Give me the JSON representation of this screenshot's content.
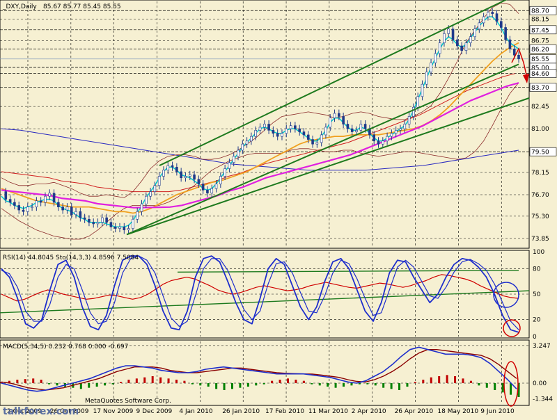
{
  "chart_data": {
    "type": "line",
    "symbol": "_DXY,Daily",
    "ohlc_readout": "85.67 85.77 85.45 85.55",
    "x_tick_labels": [
      "2 Oct 2009",
      "26 Oct 2009",
      "17 Nov 2009",
      "9 Dec 2009",
      "4 Jan 2010",
      "26 Jan 2010",
      "17 Feb 2010",
      "11 Mar 2010",
      "2 Apr 2010",
      "26 Apr 2010",
      "18 May 2010",
      "9 Jun 2010"
    ],
    "watermark": "talkforex.com",
    "copyright": "MetaQuotes Software Corp.",
    "panels": [
      {
        "name": "price",
        "ylim": [
          73.3,
          89.3
        ],
        "y_ticks": [
          88.15,
          86.75,
          85.0,
          84.6,
          82.45,
          81.0,
          78.15,
          76.7,
          75.3,
          73.85
        ],
        "boxed_labels": [
          {
            "value": 88.7,
            "text": "88.70",
            "bg": "#FFFFFF",
            "fg": "#000000"
          },
          {
            "value": 87.45,
            "text": "87.45",
            "bg": "#FFFFFF",
            "fg": "#000000"
          },
          {
            "value": 86.2,
            "text": "86.20",
            "bg": "#FFFFFF",
            "fg": "#000000"
          },
          {
            "value": 85.55,
            "text": "85.55",
            "bg": "#FFFFFF",
            "fg": "#C00000"
          },
          {
            "value": 85.0,
            "text": "85.00",
            "bg": "#FFFFFF",
            "fg": "#000000"
          },
          {
            "value": 84.6,
            "text": "84.60",
            "bg": "#FFFFFF",
            "fg": "#000000"
          },
          {
            "value": 83.7,
            "text": "83.70",
            "bg": "#FFFFFF",
            "fg": "#000000"
          },
          {
            "value": 79.5,
            "text": "79.50",
            "bg": "#FFFFFF",
            "fg": "#000000"
          }
        ],
        "horizontal_levels": [
          88.7,
          87.45,
          86.2,
          85.0,
          84.6,
          83.7,
          79.5
        ],
        "bid_line": 85.55,
        "close_series": [
          76.9,
          76.4,
          76.2,
          76.0,
          75.7,
          75.6,
          75.9,
          75.9,
          76.3,
          76.2,
          76.6,
          76.8,
          76.2,
          75.9,
          75.7,
          75.9,
          75.4,
          75.6,
          75.2,
          75.1,
          74.9,
          74.8,
          74.9,
          75.2,
          74.9,
          74.6,
          74.5,
          74.6,
          74.4,
          74.5,
          75.1,
          75.6,
          76.1,
          76.6,
          76.9,
          77.3,
          77.9,
          78.3,
          78.6,
          78.5,
          78.2,
          77.8,
          77.9,
          78.0,
          77.7,
          77.4,
          77.0,
          76.8,
          77.1,
          77.4,
          77.9,
          78.4,
          78.8,
          79.2,
          79.6,
          80.0,
          80.2,
          80.5,
          80.9,
          81.1,
          81.3,
          80.9,
          80.7,
          80.5,
          80.7,
          81.0,
          81.2,
          81.0,
          80.8,
          80.6,
          80.3,
          80.0,
          80.1,
          80.6,
          81.1,
          81.7,
          82.0,
          81.8,
          81.3,
          81.0,
          80.8,
          80.9,
          81.3,
          81.0,
          80.6,
          80.2,
          80.0,
          80.2,
          80.5,
          80.7,
          80.9,
          81.0,
          81.3,
          81.8,
          82.4,
          83.1,
          83.9,
          84.7,
          85.3,
          85.9,
          86.6,
          87.2,
          87.5,
          86.8,
          86.4,
          86.1,
          86.6,
          87.0,
          87.5,
          87.9,
          88.3,
          88.6,
          88.5,
          88.0,
          87.6,
          86.8,
          86.2,
          85.8,
          85.55
        ],
        "bb_upper": [
          77.8,
          77.5,
          77.3,
          77.3,
          77.4,
          77.4,
          77.5,
          77.3,
          77.1,
          76.8,
          76.6,
          76.6,
          76.7,
          76.6,
          76.5,
          76.9,
          77.6,
          78.4,
          78.9,
          79.2,
          79.3,
          79.3,
          79.2,
          79.0,
          79.0,
          79.1,
          79.3,
          79.6,
          80.0,
          80.4,
          80.9,
          81.4,
          81.8,
          81.9,
          82.0,
          82.1,
          82.0,
          81.9,
          81.7,
          81.8,
          82.0,
          82.1,
          82.0,
          81.8,
          81.7,
          81.6,
          81.6,
          81.8,
          82.1,
          82.5,
          83.3,
          84.3,
          85.4,
          86.6,
          87.4,
          88.2,
          88.9,
          89.2,
          89.1,
          88.5
        ],
        "bb_lower": [
          75.8,
          75.4,
          75.0,
          74.7,
          74.4,
          74.2,
          74.0,
          73.9,
          73.8,
          73.8,
          74.0,
          74.4,
          74.9,
          75.4,
          75.8,
          76.0,
          76.0,
          76.0,
          76.0,
          76.2,
          76.5,
          76.9,
          77.3,
          77.8,
          78.3,
          78.6,
          78.9,
          79.1,
          79.3,
          79.4,
          79.4,
          79.4,
          79.4,
          79.6,
          79.7,
          79.7,
          79.6,
          79.5,
          79.5,
          79.6,
          79.6,
          79.4,
          79.3,
          79.2,
          79.3,
          79.4,
          79.5,
          79.5,
          79.4,
          79.3,
          79.2,
          79.1,
          79.0,
          79.1,
          79.5,
          80.2,
          81.2,
          82.3,
          83.3,
          84.0
        ],
        "sma_short": [
          76.6,
          76.3,
          76.2,
          76.0,
          75.9,
          75.8,
          75.9,
          76.0,
          76.2,
          76.3,
          76.4,
          76.4,
          76.3,
          76.0,
          75.8,
          75.7,
          75.6,
          75.4,
          75.2,
          75.1,
          74.9,
          74.9,
          74.9,
          74.9,
          74.8,
          74.7,
          74.6,
          74.6,
          74.6,
          74.7,
          75.0,
          75.5,
          76.0,
          76.5,
          76.9,
          77.3,
          77.8,
          78.2,
          78.5,
          78.5,
          78.3,
          78.0,
          77.9,
          77.8,
          77.6,
          77.4,
          77.1,
          77.0,
          77.1,
          77.4,
          77.8,
          78.2,
          78.6,
          79.0,
          79.4,
          79.8,
          80.1,
          80.4,
          80.7,
          81.0,
          81.1,
          81.0,
          80.8,
          80.7,
          80.7,
          80.9,
          81.0,
          81.0,
          80.8,
          80.6,
          80.4,
          80.2,
          80.2,
          80.5,
          80.9,
          81.4,
          81.7,
          81.7,
          81.4,
          81.1,
          80.9,
          80.9,
          81.1,
          81.0,
          80.7,
          80.4,
          80.2,
          80.2,
          80.4,
          80.6,
          80.8,
          81.0,
          81.2,
          81.6,
          82.2,
          82.9,
          83.6,
          84.3,
          85.0,
          85.6,
          86.2,
          86.7,
          87.0,
          86.8,
          86.5,
          86.3,
          86.5,
          86.9,
          87.3,
          87.7,
          88.0,
          88.3,
          88.3,
          88.0,
          87.6,
          87.0,
          86.6,
          86.4,
          86.2
        ],
        "sma_medium": [
          77.1,
          76.9,
          76.7,
          76.5,
          76.3,
          76.2,
          76.1,
          76.0,
          75.9,
          75.9,
          75.9,
          75.8,
          75.7,
          75.6,
          75.6,
          75.5,
          75.6,
          75.8,
          76.1,
          76.4,
          76.7,
          76.9,
          77.1,
          77.3,
          77.5,
          77.6,
          77.8,
          78.0,
          78.2,
          78.5,
          78.8,
          79.1,
          79.4,
          79.7,
          80.0,
          80.2,
          80.3,
          80.4,
          80.5,
          80.5,
          80.6,
          80.6,
          80.6,
          80.6,
          80.7,
          80.8,
          80.9,
          81.0,
          81.2,
          81.5,
          81.9,
          82.4,
          83.0,
          83.6,
          84.2,
          84.8,
          85.4,
          85.9,
          86.3,
          86.6
        ],
        "sma_long": [
          78.2,
          78.1,
          78.0,
          77.9,
          77.8,
          77.6,
          77.5,
          77.4,
          77.2,
          77.1,
          77.0,
          76.9,
          76.9,
          76.9,
          76.9,
          77.0,
          77.2,
          77.4,
          77.6,
          77.9,
          78.1,
          78.4,
          78.7,
          78.9,
          79.1,
          79.3,
          79.5,
          79.7,
          79.9,
          80.1,
          80.4,
          80.7,
          81.0,
          81.3,
          81.6,
          81.9,
          82.3,
          82.7,
          83.1,
          83.5,
          83.8,
          84.1,
          84.4,
          84.6
        ],
        "sma_very_long": [
          81.0,
          80.9,
          80.7,
          80.5,
          80.3,
          80.1,
          79.9,
          79.7,
          79.5,
          79.3,
          79.1,
          78.9,
          78.7,
          78.6,
          78.5,
          78.4,
          78.3,
          78.3,
          78.3,
          78.3,
          78.4,
          78.5,
          78.6,
          78.8,
          79.0,
          79.2,
          79.4,
          79.6
        ],
        "channel_upper": [
          [
            78.6,
            229
          ],
          [
            89.8,
            745
          ]
        ],
        "channel_lower": [
          [
            74.1,
            182
          ],
          [
            85.2,
            745
          ]
        ],
        "support_line": [
          [
            74.1,
            182
          ],
          [
            83.0,
            760
          ]
        ]
      },
      {
        "name": "oscillator",
        "label": "RSI(14) 44.8045  Sto(14,3,3) 4.8596 7.5084",
        "ylim": [
          0,
          100
        ],
        "y_ticks": [
          100,
          80,
          50,
          20,
          0
        ],
        "tick_labels": [
          "100",
          "80",
          "50",
          "20",
          "0"
        ],
        "rsi": [
          50,
          46,
          42,
          44,
          48,
          52,
          55,
          53,
          50,
          48,
          46,
          44,
          45,
          47,
          49,
          48,
          46,
          44,
          46,
          50,
          56,
          62,
          66,
          68,
          70,
          68,
          64,
          60,
          55,
          52,
          50,
          52,
          55,
          58,
          60,
          58,
          56,
          54,
          55,
          57,
          60,
          62,
          64,
          62,
          60,
          58,
          57,
          59,
          61,
          63,
          62,
          60,
          58,
          60,
          63,
          66,
          70,
          73,
          72,
          70,
          68,
          65,
          60,
          56,
          52,
          48,
          46,
          45
        ],
        "stoch_k": [
          80,
          70,
          45,
          15,
          10,
          20,
          55,
          85,
          90,
          70,
          35,
          12,
          8,
          25,
          60,
          90,
          95,
          95,
          85,
          60,
          30,
          10,
          8,
          30,
          70,
          92,
          95,
          88,
          65,
          40,
          20,
          15,
          45,
          80,
          92,
          85,
          60,
          35,
          20,
          35,
          65,
          88,
          92,
          80,
          55,
          30,
          18,
          40,
          75,
          90,
          88,
          70,
          55,
          40,
          50,
          70,
          85,
          92,
          90,
          82,
          70,
          50,
          25,
          8,
          5
        ],
        "stoch_d": [
          78,
          74,
          58,
          30,
          18,
          18,
          38,
          70,
          85,
          80,
          55,
          28,
          15,
          18,
          40,
          75,
          92,
          95,
          90,
          75,
          48,
          22,
          12,
          18,
          48,
          80,
          92,
          92,
          78,
          55,
          32,
          20,
          30,
          62,
          86,
          88,
          75,
          52,
          30,
          28,
          48,
          75,
          90,
          86,
          68,
          45,
          25,
          28,
          55,
          82,
          90,
          82,
          65,
          48,
          45,
          58,
          76,
          88,
          91,
          86,
          78,
          62,
          40,
          18,
          8
        ]
      },
      {
        "name": "macd",
        "label": "MACD(5,34,5) 0.232 0.768 0.000 -0.697",
        "tick_labels": [
          "3.247",
          "0.00",
          "-1.344"
        ],
        "ylim": [
          -1.8,
          3.6
        ],
        "macd_line": [
          0.0,
          -0.2,
          -0.4,
          -0.6,
          -0.7,
          -0.6,
          -0.4,
          -0.2,
          0.0,
          0.2,
          0.4,
          0.7,
          1.0,
          1.3,
          1.5,
          1.5,
          1.4,
          1.3,
          1.1,
          1.0,
          0.9,
          0.9,
          1.0,
          1.2,
          1.3,
          1.4,
          1.3,
          1.2,
          1.1,
          1.0,
          0.9,
          0.8,
          0.8,
          0.8,
          0.8,
          0.7,
          0.6,
          0.5,
          0.3,
          0.1,
          0.0,
          0.2,
          0.6,
          1.0,
          1.6,
          2.3,
          2.9,
          3.1,
          2.9,
          2.7,
          2.5,
          2.5,
          2.5,
          2.4,
          2.2,
          1.7,
          1.0,
          0.3,
          -0.5
        ],
        "signal_line": [
          0.1,
          0.0,
          -0.2,
          -0.4,
          -0.5,
          -0.6,
          -0.5,
          -0.4,
          -0.2,
          0.0,
          0.2,
          0.4,
          0.7,
          1.0,
          1.2,
          1.4,
          1.4,
          1.4,
          1.3,
          1.1,
          1.0,
          0.9,
          0.9,
          1.0,
          1.1,
          1.2,
          1.3,
          1.3,
          1.2,
          1.1,
          1.0,
          0.9,
          0.85,
          0.82,
          0.8,
          0.78,
          0.7,
          0.6,
          0.5,
          0.3,
          0.15,
          0.1,
          0.3,
          0.6,
          1.0,
          1.5,
          2.1,
          2.6,
          2.9,
          2.9,
          2.8,
          2.7,
          2.6,
          2.5,
          2.4,
          2.1,
          1.6,
          1.0,
          0.4
        ],
        "histogram": [
          0.1,
          0.2,
          0.3,
          0.35,
          0.4,
          0.3,
          -0.1,
          -0.2,
          -0.3,
          -0.4,
          -0.5,
          -0.4,
          -0.3,
          -0.2,
          -0.1,
          0.1,
          0.3,
          0.4,
          0.5,
          0.6,
          0.5,
          0.4,
          0.3,
          0.2,
          -0.1,
          -0.2,
          -0.3,
          -0.5,
          -0.6,
          -0.5,
          -0.4,
          -0.3,
          -0.2,
          -0.1,
          0.2,
          0.3,
          0.4,
          0.3,
          0.2,
          -0.1,
          -0.2,
          -0.3,
          -0.4,
          -0.3,
          -0.2,
          -0.1,
          -0.1,
          -0.2,
          -0.4,
          -0.5,
          -0.6,
          -0.3,
          0.1,
          0.3,
          0.5,
          0.6,
          0.7,
          0.6,
          0.4,
          0.2,
          -0.2,
          -0.4,
          -0.6,
          -0.8,
          -1.0,
          -1.2
        ]
      }
    ]
  },
  "colors": {
    "background": "#F6F0D2",
    "grid": "#000000",
    "candle_up": "#1F3A8A",
    "candle_down": "#1F3A8A",
    "bb": "#8B2A2A",
    "sma_short": "#00C8D0",
    "sma_medium": "#F0A020",
    "sma_long": "#E020E0",
    "sma_very_long": "#2828C0",
    "ma_red": "#D02020",
    "channel": "#1E7A1E",
    "rsi": "#D00000",
    "stoch": "#1E2ECC",
    "macd_line": "#1E2ECC",
    "signal_line": "#8B0000",
    "hist_pos": "#C00000",
    "hist_neg": "#008000",
    "annotation": "#D00000",
    "circle_blue": "#1E2ECC"
  }
}
